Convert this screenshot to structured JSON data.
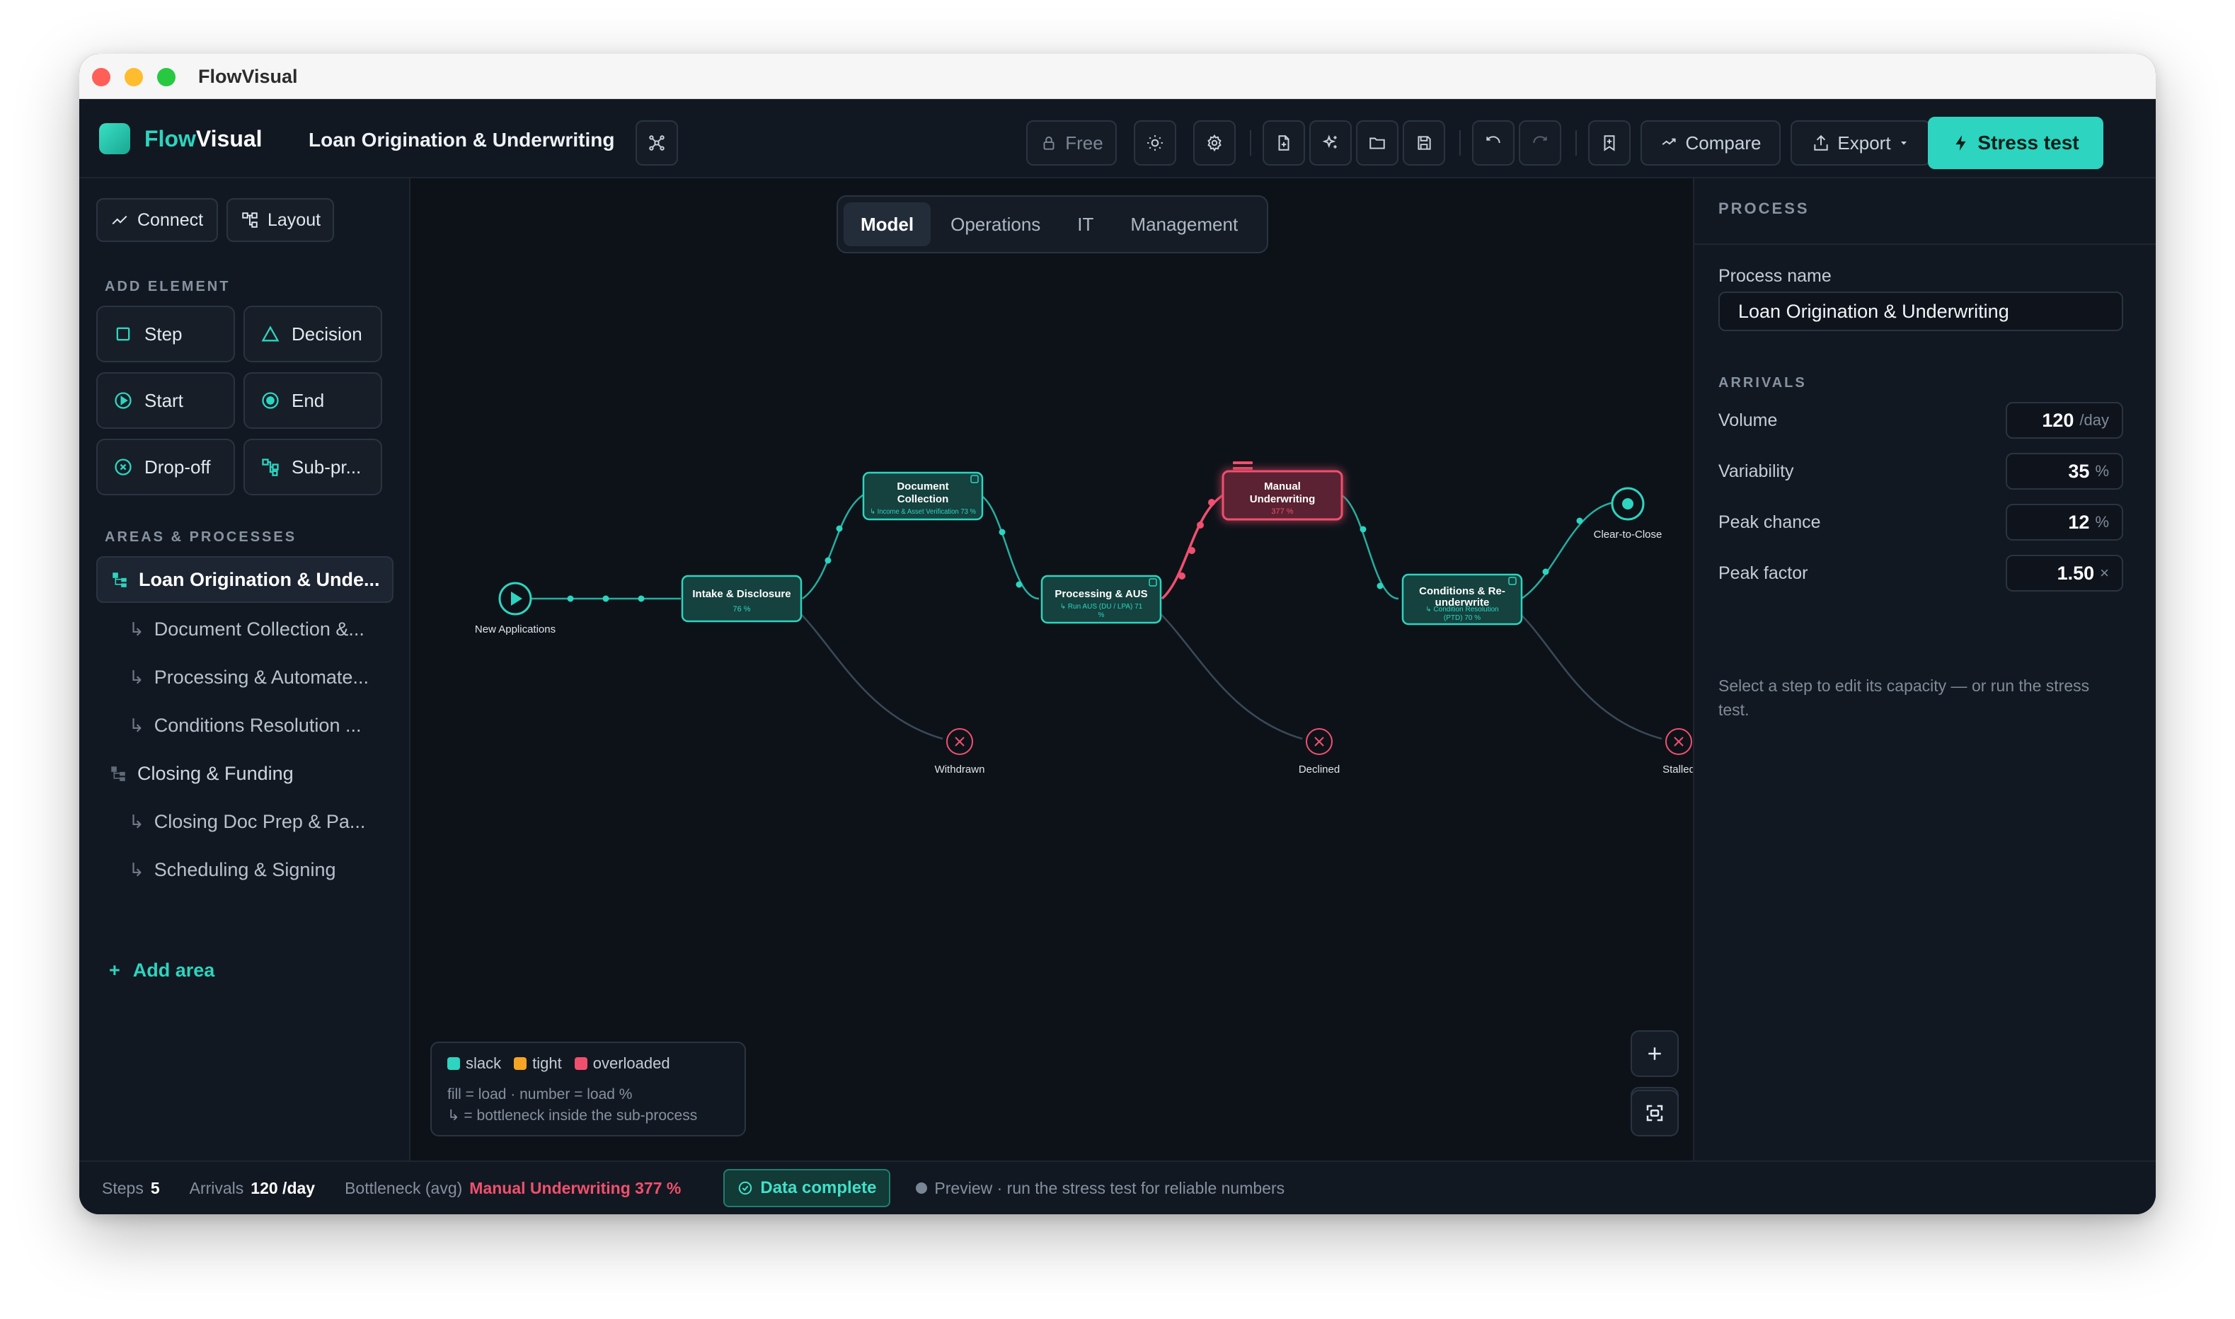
{
  "window": {
    "title": "FlowVisual"
  },
  "header": {
    "brand_part1": "Flow",
    "brand_part2": "Visual",
    "process_title": "Loan Origination & Underwriting",
    "free_label": "Free",
    "compare_label": "Compare",
    "export_label": "Export",
    "stress_label": "Stress test"
  },
  "sidebar": {
    "connect_label": "Connect",
    "layout_label": "Layout",
    "add_element_label": "ADD ELEMENT",
    "elements": [
      {
        "label": "Step",
        "icon": "square-icon"
      },
      {
        "label": "Decision",
        "icon": "triangle-icon"
      },
      {
        "label": "Start",
        "icon": "play-circle-icon"
      },
      {
        "label": "End",
        "icon": "stop-circle-icon"
      },
      {
        "label": "Drop-off",
        "icon": "x-circle-icon"
      },
      {
        "label": "Sub-pr...",
        "icon": "subprocess-icon"
      }
    ],
    "areas_label": "AREAS & PROCESSES",
    "tree": [
      {
        "label": "Loan Origination & Unde...",
        "level": 0,
        "active": true
      },
      {
        "label": "Document Collection &...",
        "level": 1
      },
      {
        "label": "Processing & Automate...",
        "level": 1
      },
      {
        "label": "Conditions Resolution ...",
        "level": 1
      },
      {
        "label": "Closing & Funding",
        "level": 0
      },
      {
        "label": "Closing Doc Prep & Pa...",
        "level": 1
      },
      {
        "label": "Scheduling & Signing",
        "level": 1
      }
    ],
    "child_marker": "↳",
    "add_area_label": "Add area"
  },
  "canvas": {
    "tabs": [
      "Model",
      "Operations",
      "IT",
      "Management"
    ],
    "active_tab": "Model",
    "nodes": {
      "start": "New Applications",
      "intake": {
        "title": "Intake & Disclosure",
        "sub": "76 %"
      },
      "doc": {
        "title_1": "Document",
        "title_2": "Collection",
        "sub": "↳ Income & Asset Verification 73 %"
      },
      "proc": {
        "title": "Processing & AUS",
        "sub_1": "↳ Run AUS (DU / LPA) 71",
        "sub_2": "%"
      },
      "manual": {
        "title_1": "Manual",
        "title_2": "Underwriting",
        "sub": "377 %"
      },
      "cond": {
        "title_1": "Conditions & Re-",
        "title_2": "underwrite",
        "sub_1": "↳ Condition Resolution",
        "sub_2": "(PTD) 70 %"
      },
      "end": "Clear-to-Close",
      "drop1": "Withdrawn",
      "drop2": "Declined",
      "drop3": "Stalled"
    },
    "legend": {
      "slack": "slack",
      "tight": "tight",
      "overloaded": "overloaded",
      "note1": "fill = load · number = load %",
      "note2": "↳ = bottleneck inside the sub-process"
    },
    "colors": {
      "slack": "#2dd4bf",
      "tight": "#f5a524",
      "overloaded": "#f0506e"
    }
  },
  "panel": {
    "header": "PROCESS",
    "name_label": "Process name",
    "name_value": "Loan Origination & Underwriting",
    "arrivals_label": "ARRIVALS",
    "fields": [
      {
        "label": "Volume",
        "value": "120",
        "unit": "/day"
      },
      {
        "label": "Variability",
        "value": "35",
        "unit": "%"
      },
      {
        "label": "Peak chance",
        "value": "12",
        "unit": "%"
      },
      {
        "label": "Peak factor",
        "value": "1.50",
        "unit": "×"
      }
    ],
    "hint": "Select a step to edit its capacity — or run the stress test."
  },
  "status": {
    "steps_label": "Steps",
    "steps_value": "5",
    "arrivals_label": "Arrivals",
    "arrivals_value": "120 /day",
    "bottleneck_label": "Bottleneck (avg)",
    "bottleneck_value": "Manual Underwriting 377 %",
    "data_complete": "Data complete",
    "preview": "Preview · run the stress test for reliable numbers"
  }
}
